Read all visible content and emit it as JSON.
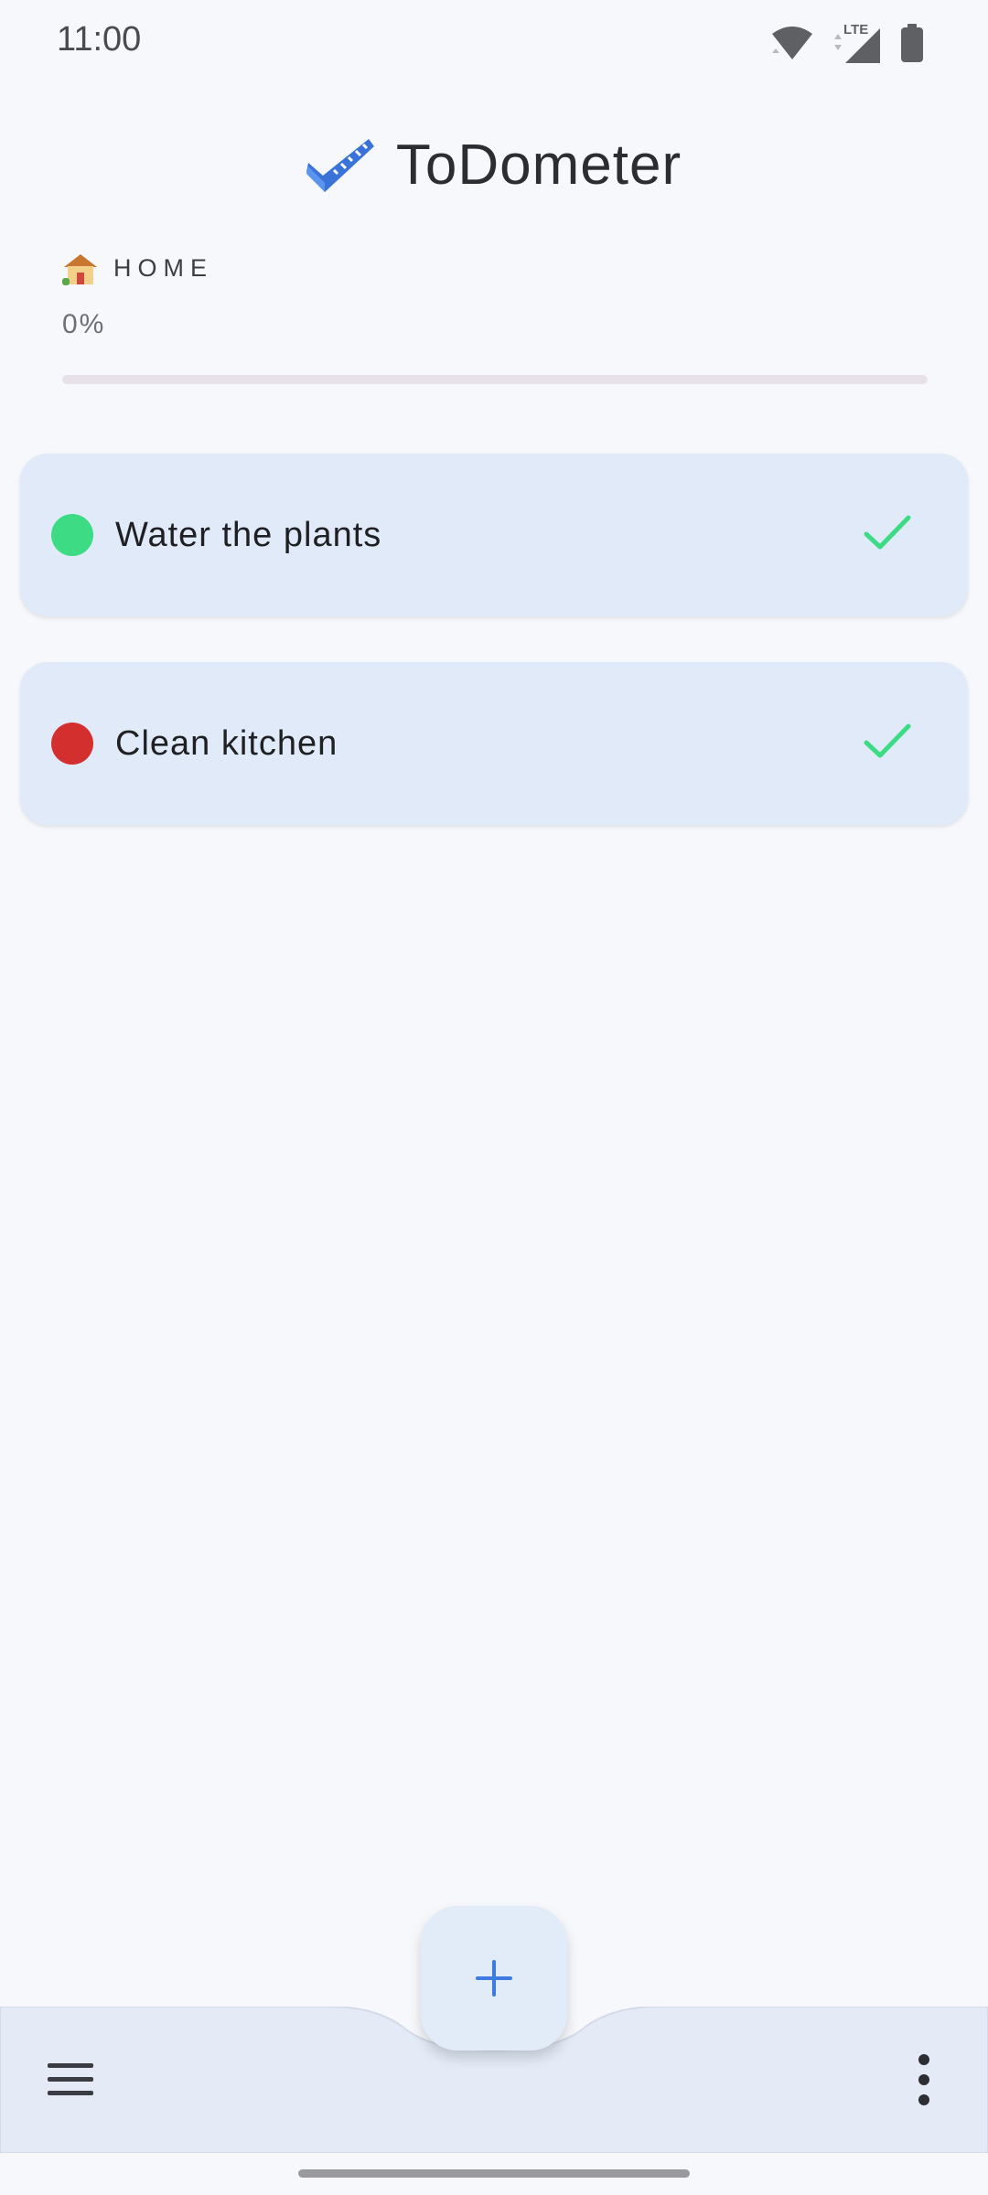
{
  "status_bar": {
    "time": "11:00",
    "network_label": "LTE",
    "icons": [
      "wifi-icon",
      "cellular-signal-icon",
      "battery-icon"
    ]
  },
  "header": {
    "title": "ToDometer",
    "logo_icon": "ruler-check-logo-icon"
  },
  "project": {
    "emoji_icon": "house-emoji-icon",
    "name": "HOME",
    "progress_text": "0%",
    "progress_fraction": 0
  },
  "tasks": [
    {
      "name": "Water the plants",
      "dot_color": "#3ddc84",
      "check_color": "#3ddc84"
    },
    {
      "name": "Clean kitchen",
      "dot_color": "#d32f2f",
      "check_color": "#3ddc84"
    }
  ],
  "bottom_bar": {
    "menu_icon": "hamburger-menu-icon",
    "more_icon": "more-vertical-icon",
    "fab_icon": "plus-icon"
  },
  "colors": {
    "background": "#f6f8fc",
    "card": "#e1eaf8",
    "bottom_bar": "#e4ebf7",
    "accent": "#3d7be0"
  }
}
